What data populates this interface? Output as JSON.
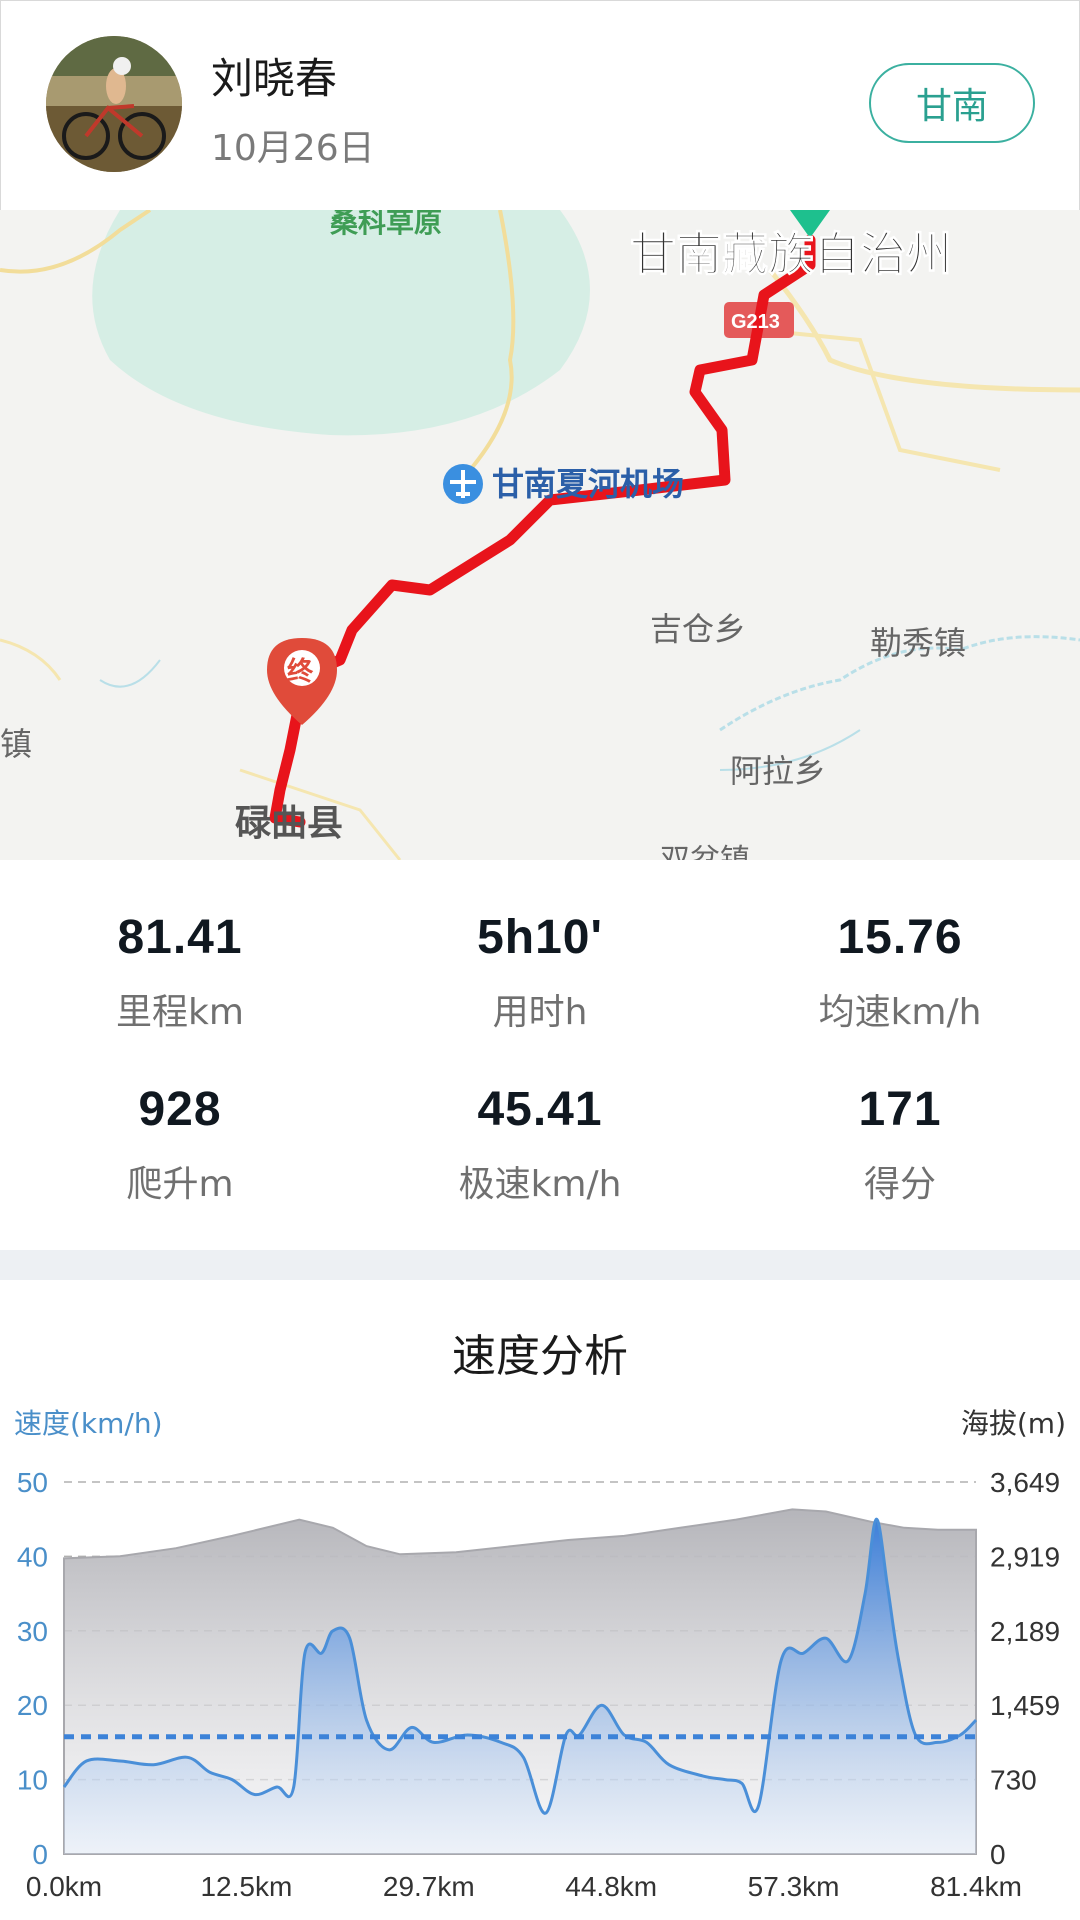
{
  "header": {
    "user_name": "刘晓春",
    "date": "10月26日",
    "region_button": "甘南"
  },
  "map": {
    "labels": {
      "grassland": "桑科草原",
      "prefecture": "甘南藏族自治州",
      "road": "G213",
      "airport": "甘南夏河机场",
      "jicang": "吉仓乡",
      "lexiu": "勒秀镇",
      "zhen_left": "镇",
      "ala": "阿拉乡",
      "county": "碌曲县",
      "shuangcha": "双岔镇",
      "end_marker": "终"
    },
    "colors": {
      "route": "#e8141b",
      "start_marker": "#1ec08e",
      "end_marker": "#e04b3a"
    }
  },
  "stats": [
    {
      "value": "81.41",
      "label": "里程km"
    },
    {
      "value": "5h10'",
      "label": "用时h"
    },
    {
      "value": "15.76",
      "label": "均速km/h"
    },
    {
      "value": "928",
      "label": "爬升m"
    },
    {
      "value": "45.41",
      "label": "极速km/h"
    },
    {
      "value": "171",
      "label": "得分"
    }
  ],
  "chart_title": "速度分析",
  "chart_data": {
    "type": "area",
    "title": "速度分析",
    "ylabel_left": "速度(km/h)",
    "ylabel_right": "海拔(m)",
    "x_tick_labels": [
      "0.0km",
      "12.5km",
      "29.7km",
      "44.8km",
      "57.3km",
      "81.4km"
    ],
    "x_range": [
      0,
      81.4
    ],
    "y_left_ticks": [
      "0",
      "10",
      "20",
      "30",
      "40",
      "50"
    ],
    "y_left_range": [
      0,
      50
    ],
    "y_right_ticks": [
      "0",
      "730",
      "1,459",
      "2,189",
      "2,919",
      "3,649"
    ],
    "y_right_range": [
      0,
      3649
    ],
    "average_speed": 15.76,
    "grid": true,
    "series": [
      {
        "name": "速度(km/h)",
        "color": "#4a8fd8",
        "x": [
          0,
          2,
          5,
          8,
          11,
          13,
          15,
          17,
          19,
          20.5,
          21.5,
          23,
          24,
          25.5,
          27,
          29,
          31,
          33,
          36,
          39,
          41,
          43,
          44.8,
          46,
          48,
          50,
          52,
          54,
          57,
          59,
          60.5,
          62,
          64,
          66,
          68,
          70,
          71.5,
          72.5,
          73.5,
          74.5,
          76,
          78,
          80,
          81.4
        ],
        "y": [
          9,
          12.5,
          12.5,
          12,
          13,
          11,
          10,
          8,
          9,
          9,
          27,
          27,
          30,
          29,
          18,
          14,
          17,
          15,
          16,
          15,
          13,
          5.5,
          16,
          16,
          20,
          16,
          15,
          12,
          10.5,
          10,
          9.5,
          6.5,
          26,
          27,
          29,
          26,
          35,
          45,
          36,
          26,
          16,
          15,
          16,
          18
        ]
      },
      {
        "name": "海拔(m)",
        "color": "#9a9aa2",
        "x": [
          0,
          5,
          10,
          15,
          21,
          24,
          27,
          30,
          35,
          40,
          45,
          50,
          55,
          60,
          65,
          68,
          72,
          75,
          78,
          81.4
        ],
        "y": [
          2900,
          2920,
          3000,
          3120,
          3280,
          3200,
          3020,
          2940,
          2960,
          3020,
          3080,
          3120,
          3200,
          3280,
          3380,
          3360,
          3260,
          3200,
          3180,
          3180
        ]
      }
    ]
  }
}
